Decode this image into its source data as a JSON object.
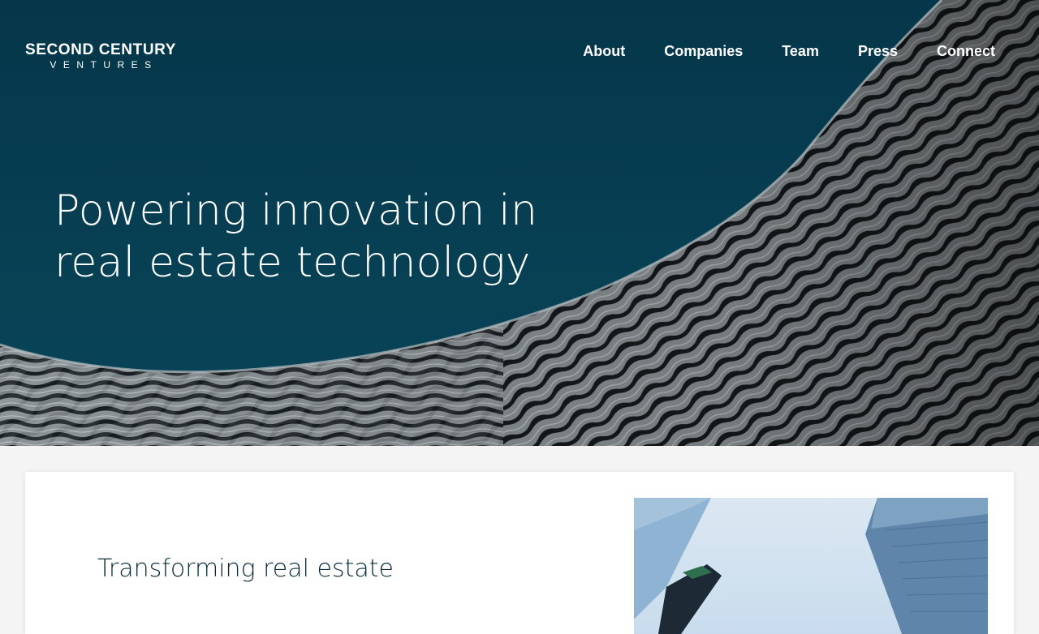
{
  "brand": {
    "name_line1": "SECOND CENTURY",
    "name_line2": "VENTURES"
  },
  "nav": {
    "items": [
      {
        "label": "About"
      },
      {
        "label": "Companies"
      },
      {
        "label": "Team"
      },
      {
        "label": "Press"
      },
      {
        "label": "Connect"
      }
    ]
  },
  "hero": {
    "headline": "Powering innovation in real estate technology"
  },
  "intro": {
    "title": "Transforming real estate"
  },
  "colors": {
    "hero_background": "#073f53",
    "page_background": "#f4f4f4",
    "card_background": "#ffffff",
    "title_text": "#0b2c3a",
    "nav_text": "#ffffff"
  }
}
